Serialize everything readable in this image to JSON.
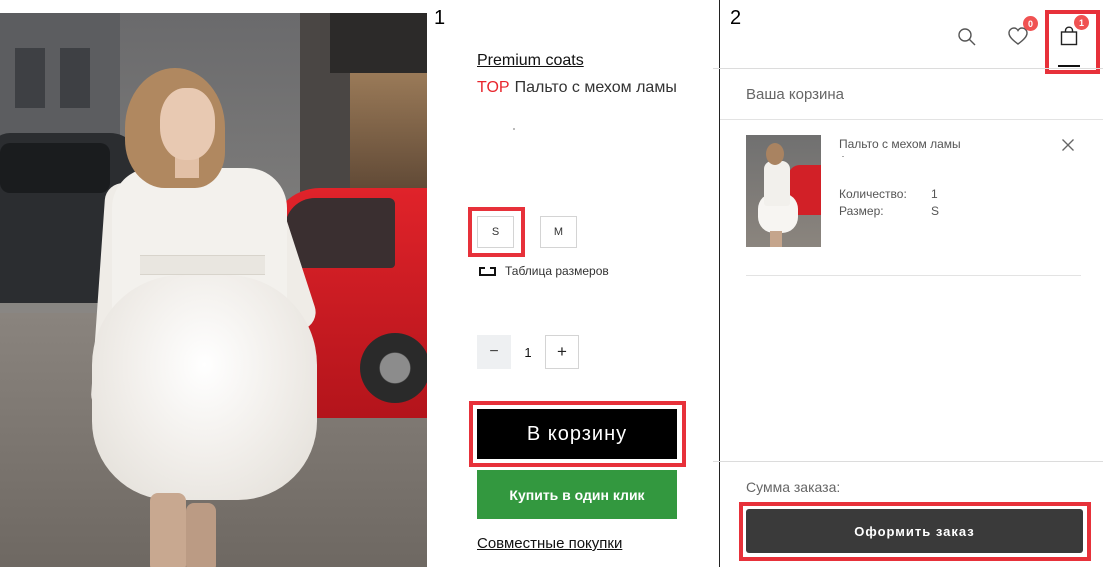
{
  "panels": {
    "left_number": "1",
    "right_number": "2"
  },
  "product": {
    "photo": "woman-in-white-coat-with-llama-fur-photo",
    "brand_link": "Premium coats",
    "badge": "TOP",
    "title": "Пальто с мехом ламы",
    "sizes": [
      "S",
      "M"
    ],
    "selected_size": "S",
    "size_table_link": "Таблица размеров",
    "quantity": {
      "minus_label": "−",
      "value": "1",
      "plus_label": "+"
    },
    "add_to_cart_label": "В корзину",
    "buy_one_click_label": "Купить в один клик",
    "group_buy_link": "Совместные покупки"
  },
  "header": {
    "icons": [
      "search-icon",
      "heart-icon",
      "bag-icon"
    ],
    "wishlist_count": "0",
    "cart_count": "1"
  },
  "cart": {
    "title": "Ваша корзина",
    "item": {
      "name": "Пальто с мехом ламы",
      "quantity_label": "Количество:",
      "quantity_value": "1",
      "size_label": "Размер:",
      "size_value": "S"
    },
    "sum_label": "Сумма заказа:",
    "checkout_label": "Оформить заказ"
  },
  "colors": {
    "accent_red": "#e8262d",
    "highlight_box": "#e7313a",
    "buy_green": "#33983f",
    "badge_red": "#f05252",
    "checkout_dark": "#3a3a3a"
  }
}
